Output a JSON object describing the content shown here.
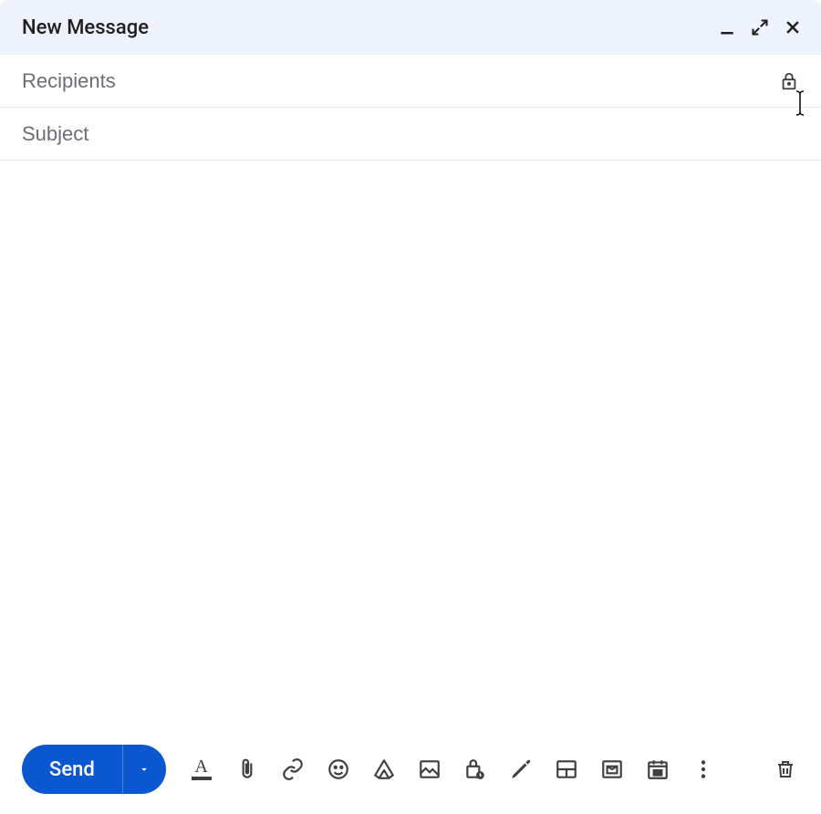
{
  "header": {
    "title": "New Message"
  },
  "fields": {
    "recipients_placeholder": "Recipients",
    "recipients_value": "",
    "subject_placeholder": "Subject",
    "subject_value": ""
  },
  "body": {
    "value": ""
  },
  "toolbar": {
    "send_label": "Send"
  },
  "icons": {
    "minimize": "minimize-icon",
    "expand": "expand-icon",
    "close": "close-icon",
    "lock": "lock-icon",
    "send_options": "caret-down-icon",
    "format": "text-format-icon",
    "attach": "paperclip-icon",
    "link": "link-icon",
    "emoji": "emoji-icon",
    "drive": "drive-icon",
    "image": "image-icon",
    "confidential": "lock-clock-icon",
    "signature": "pen-icon",
    "layout": "layout-icon",
    "templates": "envelope-icon",
    "schedule": "calendar-icon",
    "more": "more-vert-icon",
    "trash": "trash-icon"
  },
  "colors": {
    "header_bg": "#edf2fc",
    "primary": "#0b57d0",
    "icon": "#3c4043",
    "placeholder": "#6b6e73"
  }
}
